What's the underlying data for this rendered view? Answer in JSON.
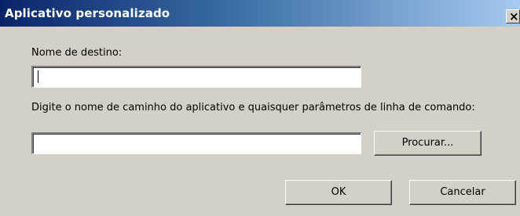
{
  "window": {
    "title": "Aplicativo personalizado",
    "close_glyph": "×",
    "titlebar_colors": [
      "#0a246a",
      "#3a6ea5",
      "#a6caf0"
    ],
    "face_color": "#d4d0c8"
  },
  "form": {
    "target_name_label": "Nome de destino:",
    "target_name_value": "",
    "path_label": "Digite o nome de caminho do aplicativo e quaisquer parâmetros de linha de comando:",
    "path_value": ""
  },
  "buttons": {
    "browse_label": "Procurar...",
    "ok_label": "OK",
    "cancel_label": "Cancelar"
  }
}
